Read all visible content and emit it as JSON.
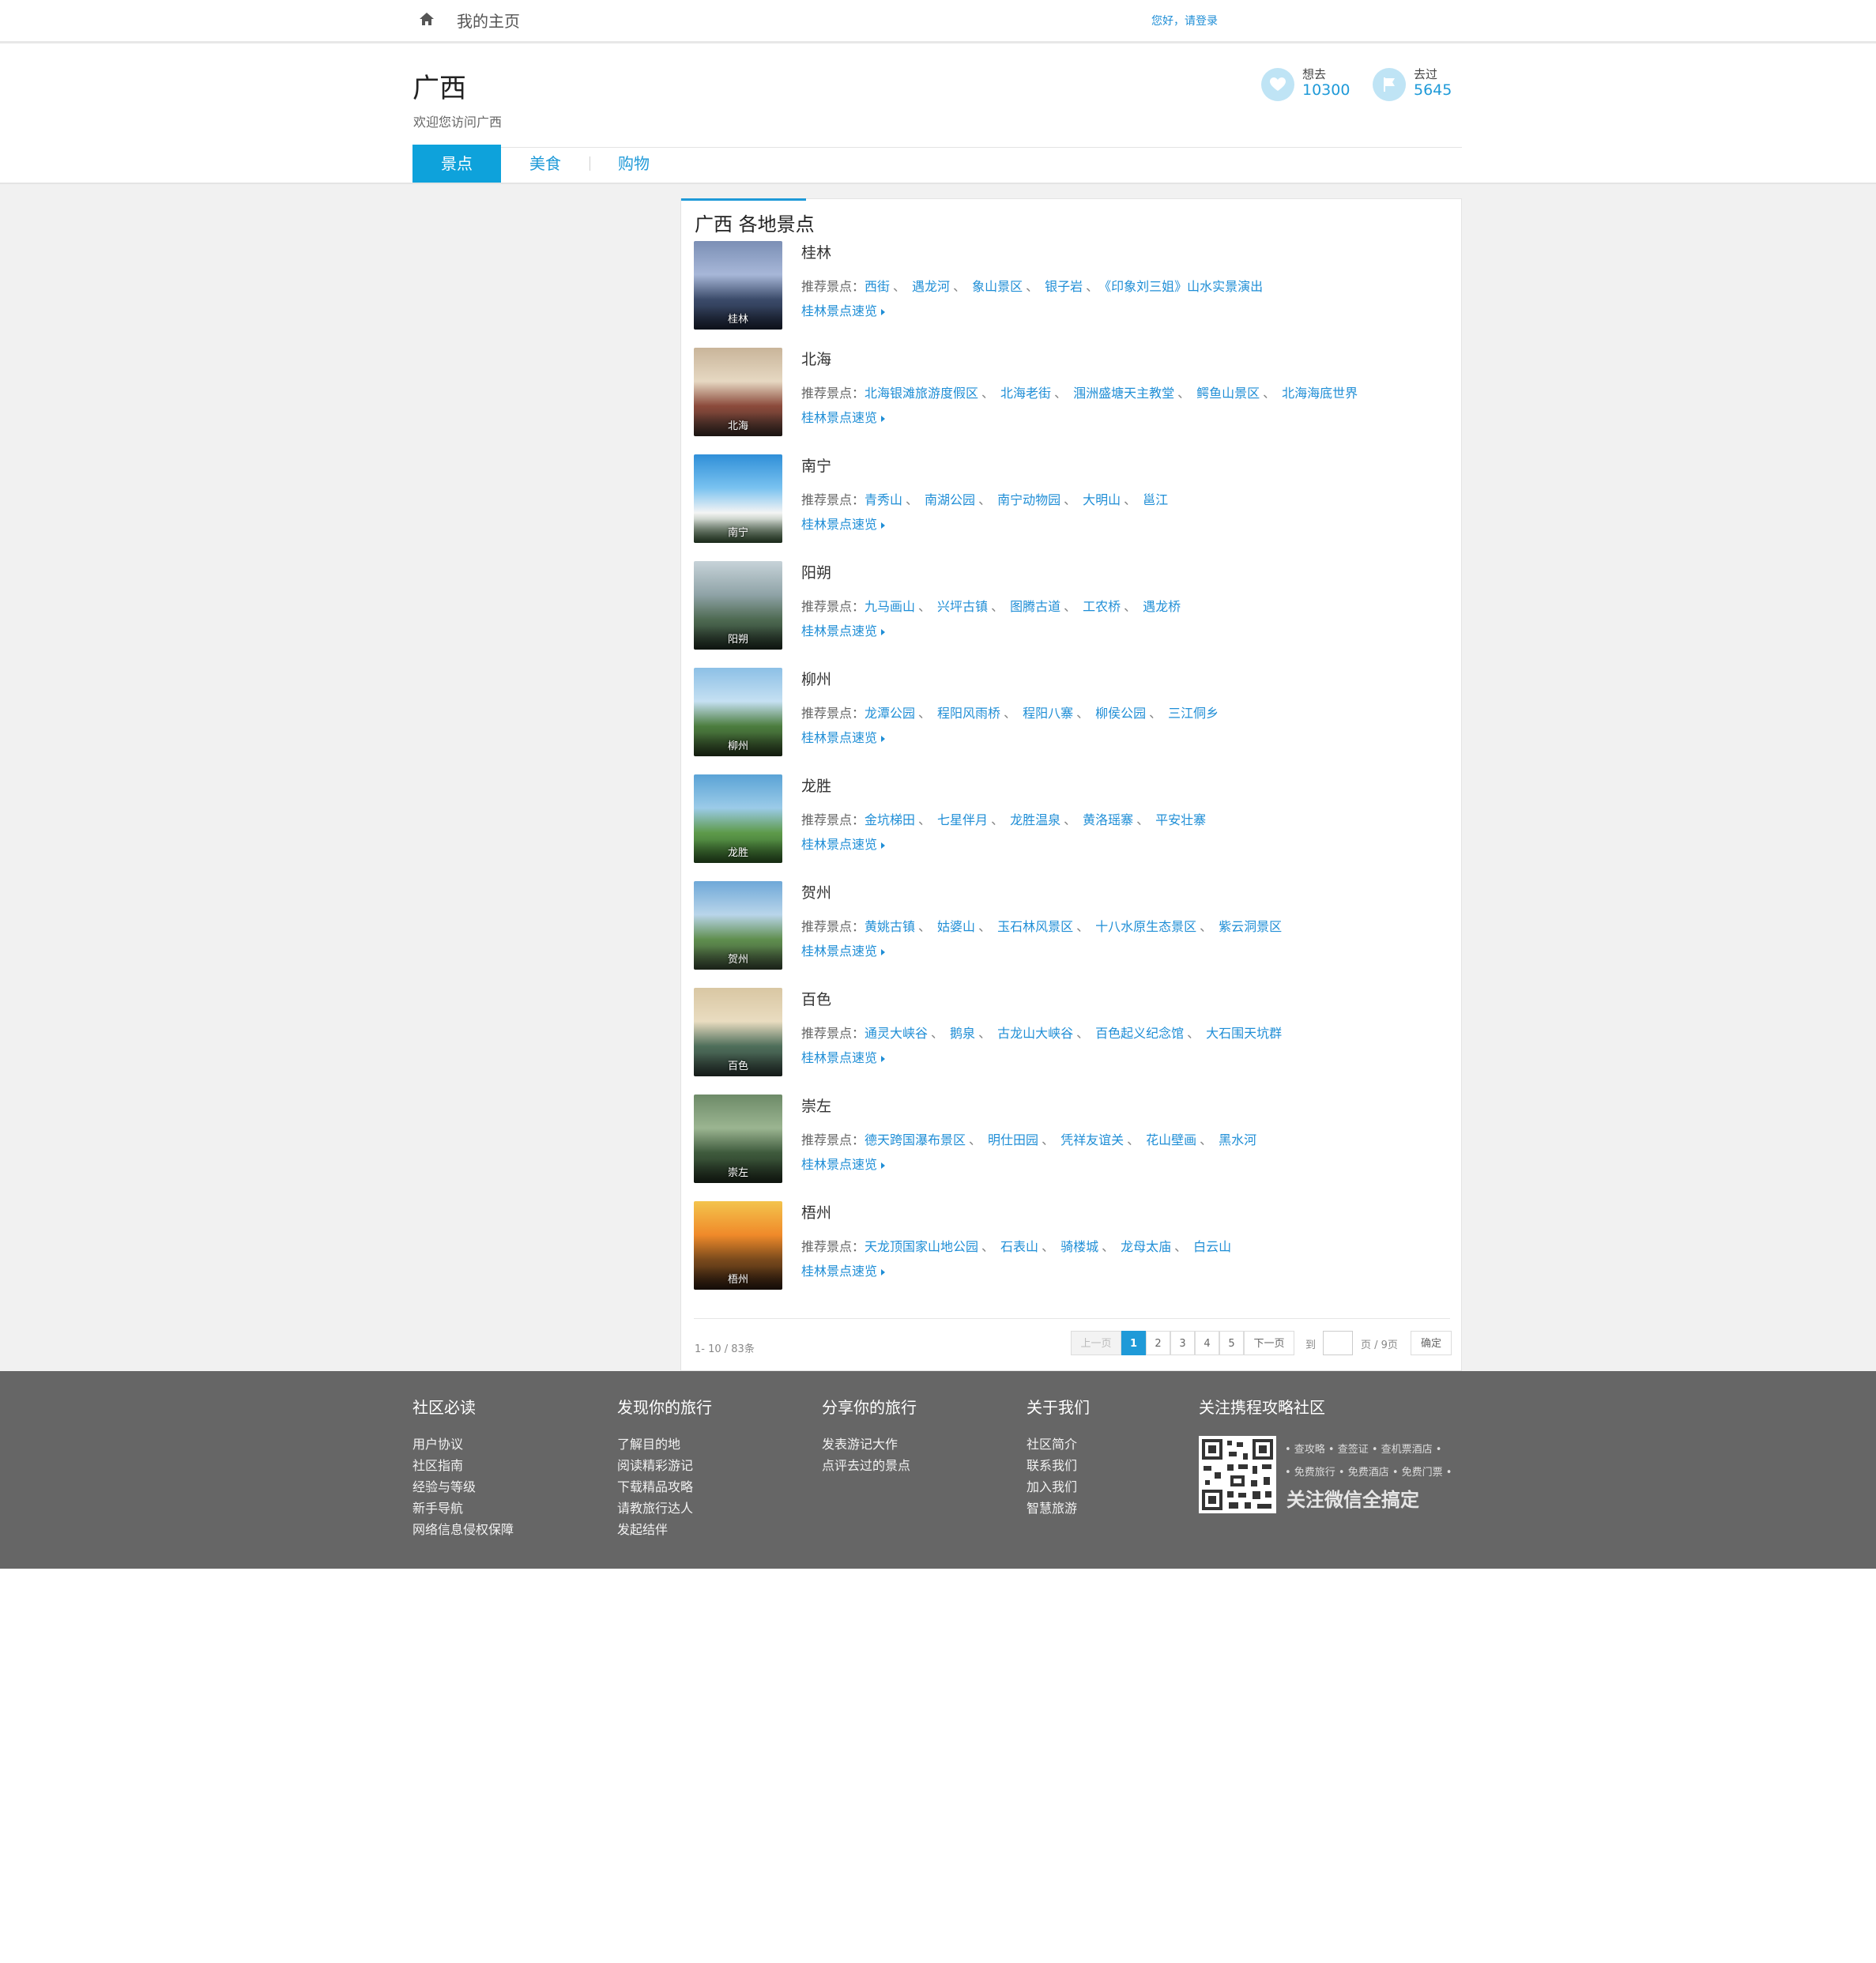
{
  "topbar": {
    "home_icon": "home-icon",
    "my_home": "我的主页",
    "login": "您好，请登录"
  },
  "header": {
    "title": "广西",
    "subtitle": "欢迎您访问广西",
    "want": {
      "label": "想去",
      "count": "10300",
      "icon": "heart-icon"
    },
    "been": {
      "label": "去过",
      "count": "5645",
      "icon": "flag-icon"
    },
    "tabs": [
      {
        "label": "景点",
        "active": true
      },
      {
        "label": "美食",
        "active": false
      },
      {
        "label": "购物",
        "active": false
      }
    ]
  },
  "panel": {
    "title": "广西 各地景点",
    "rec_label": "推荐景点：",
    "separator": "、",
    "cities": [
      {
        "name": "桂林",
        "quick": "桂林景点速览",
        "spots": [
          "西街",
          "遇龙河",
          "象山景区",
          "银子岩",
          "《印象刘三姐》山水实景演出"
        ]
      },
      {
        "name": "北海",
        "quick": "桂林景点速览",
        "spots": [
          "北海银滩旅游度假区",
          "北海老街",
          "涠洲盛塘天主教堂",
          "鳄鱼山景区",
          "北海海底世界"
        ]
      },
      {
        "name": "南宁",
        "quick": "桂林景点速览",
        "spots": [
          "青秀山",
          "南湖公园",
          "南宁动物园",
          "大明山",
          "邕江"
        ]
      },
      {
        "name": "阳朔",
        "quick": "桂林景点速览",
        "spots": [
          "九马画山",
          "兴坪古镇",
          "图腾古道",
          "工农桥",
          "遇龙桥"
        ]
      },
      {
        "name": "柳州",
        "quick": "桂林景点速览",
        "spots": [
          "龙潭公园",
          "程阳风雨桥",
          "程阳八寨",
          "柳侯公园",
          "三江侗乡"
        ]
      },
      {
        "name": "龙胜",
        "quick": "桂林景点速览",
        "spots": [
          "金坑梯田",
          "七星伴月",
          "龙胜温泉",
          "黄洛瑶寨",
          "平安壮寨"
        ]
      },
      {
        "name": "贺州",
        "quick": "桂林景点速览",
        "spots": [
          "黄姚古镇",
          "姑婆山",
          "玉石林风景区",
          "十八水原生态景区",
          "紫云洞景区"
        ]
      },
      {
        "name": "百色",
        "quick": "桂林景点速览",
        "spots": [
          "通灵大峡谷",
          "鹅泉",
          "古龙山大峡谷",
          "百色起义纪念馆",
          "大石围天坑群"
        ]
      },
      {
        "name": "崇左",
        "quick": "桂林景点速览",
        "spots": [
          "德天跨国瀑布景区",
          "明仕田园",
          "凭祥友谊关",
          "花山壁画",
          "黑水河"
        ]
      },
      {
        "name": "梧州",
        "quick": "桂林景点速览",
        "spots": [
          "天龙顶国家山地公园",
          "石表山",
          "骑楼城",
          "龙母太庙",
          "白云山"
        ]
      }
    ],
    "count": "1- 10 / 83条",
    "pager": {
      "prev": "上一页",
      "pages": [
        "1",
        "2",
        "3",
        "4",
        "5"
      ],
      "current": "1",
      "next": "下一页",
      "to": "到",
      "total": "页 / 9页",
      "confirm": "确定"
    }
  },
  "footer": {
    "columns": [
      {
        "title": "社区必读",
        "links": [
          "用户协议",
          "社区指南",
          "经验与等级",
          "新手导航",
          "网络信息侵权保障"
        ]
      },
      {
        "title": "发现你的旅行",
        "links": [
          "了解目的地",
          "阅读精彩游记",
          "下载精品攻略",
          "请教旅行达人",
          "发起结伴"
        ]
      },
      {
        "title": "分享你的旅行",
        "links": [
          "发表游记大作",
          "点评去过的景点"
        ]
      },
      {
        "title": "关于我们",
        "links": [
          "社区简介",
          "联系我们",
          "加入我们",
          "智慧旅游"
        ]
      }
    ],
    "wechat": {
      "title": "关注携程攻略社区",
      "line1": "• 查攻略 • 查签证 • 查机票酒店 •",
      "line2": "• 免费旅行 • 免费酒店 • 免费门票 •",
      "big": "关注微信全搞定",
      "qr_icon": "qr-code-icon"
    }
  },
  "colors": {
    "accent": "#1f9ad8",
    "tab_active": "#0ea2db",
    "footer_bg": "#666666",
    "page_bg": "#f1f1f1"
  }
}
